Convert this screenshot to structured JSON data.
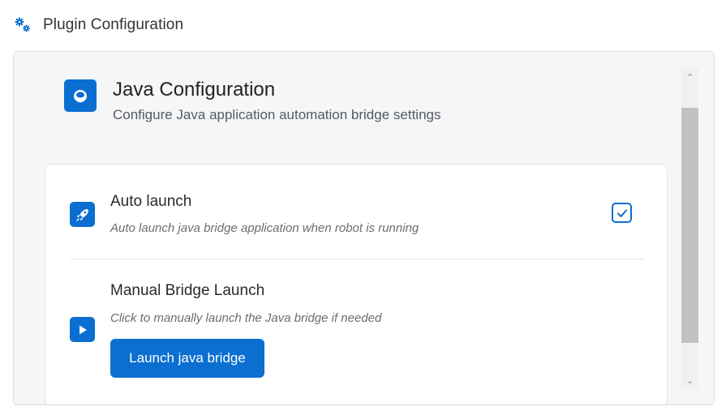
{
  "header": {
    "title": "Plugin Configuration",
    "icon": "gears-icon"
  },
  "config": {
    "title": "Java Configuration",
    "subtitle": "Configure Java application automation bridge settings",
    "icon": "java-cup-icon"
  },
  "settings": {
    "auto_launch": {
      "title": "Auto launch",
      "description": "Auto launch java bridge application when robot is running",
      "icon": "rocket-icon",
      "checked": true
    },
    "manual_launch": {
      "title": "Manual Bridge Launch",
      "description": "Click to manually launch the Java bridge if needed",
      "icon": "play-icon",
      "button_label": "Launch java bridge"
    }
  },
  "colors": {
    "accent": "#0a6fd0",
    "panel_bg": "#f5f6f8",
    "card_bg": "#ffffff"
  }
}
